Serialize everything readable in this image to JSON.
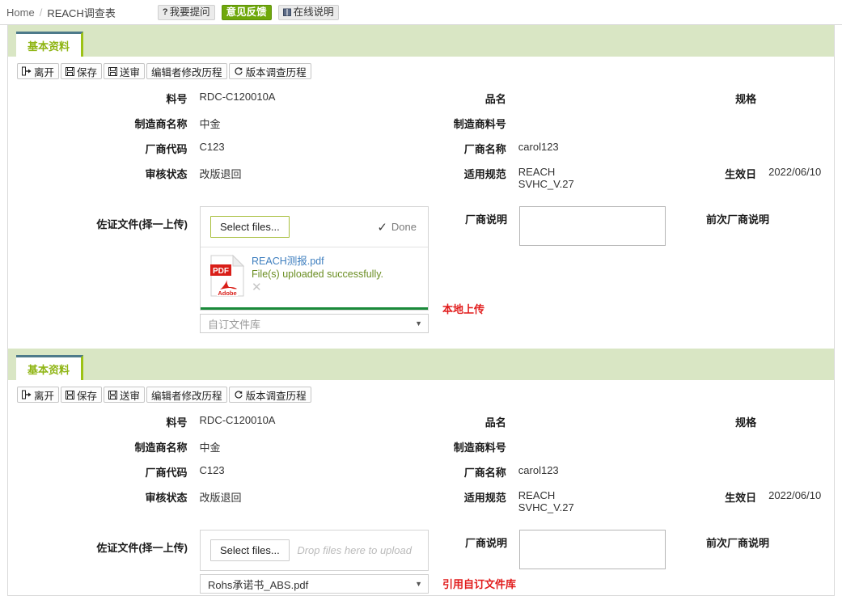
{
  "breadcrumb": {
    "home": "Home",
    "separator": "/",
    "current": "REACH调查表"
  },
  "header_buttons": [
    {
      "label": "我要提问",
      "icon": "question-mark-icon",
      "style": "plain"
    },
    {
      "label": "意见反馈",
      "icon": "none",
      "style": "accent"
    },
    {
      "label": "在线说明",
      "icon": "book-icon",
      "style": "plain"
    }
  ],
  "tab": {
    "label": "基本资料"
  },
  "toolbar": [
    {
      "label": "离开",
      "icon": "exit-icon"
    },
    {
      "label": "保存",
      "icon": "save-icon"
    },
    {
      "label": "送审",
      "icon": "save-icon"
    },
    {
      "label": "编辑者修改历程",
      "icon": "none"
    },
    {
      "label": "版本调查历程",
      "icon": "history-icon"
    }
  ],
  "fields": {
    "part_no_label": "料号",
    "part_no_value": "RDC-C120010A",
    "product_name_label": "品名",
    "product_name_value": "",
    "spec_label": "规格",
    "spec_value": "",
    "maker_name_label": "制造商名称",
    "maker_name_value": "中金",
    "maker_part_label": "制造商料号",
    "maker_part_value": "",
    "vendor_code_label": "厂商代码",
    "vendor_code_value": "C123",
    "vendor_name_label": "厂商名称",
    "vendor_name_value": "carol123",
    "review_status_label": "审核状态",
    "review_status_value": "改版退回",
    "regulation_label": "适用规范",
    "regulation_value": "REACH\nSVHC_V.27",
    "effective_date_label": "生效日",
    "effective_date_value": "2022/06/10",
    "attachment_label": "佐证文件(择一上传)",
    "vendor_remark_label": "厂商说明",
    "vendor_remark_value": "",
    "prev_vendor_remark_label": "前次厂商说明"
  },
  "panel_top": {
    "uploader": {
      "select_label": "Select files...",
      "status_label": "Done",
      "status_icon": "check-icon",
      "file_name": "REACH测报.pdf",
      "file_status": "File(s) uploaded successfully.",
      "file_icon": "pdf-file-icon",
      "remove_icon": "close-icon",
      "progress_percent": 100
    },
    "combo": {
      "value": "自订文件库",
      "is_placeholder": true,
      "arrow_icon": "chevron-down-icon"
    },
    "note": "本地上传"
  },
  "panel_bottom": {
    "uploader": {
      "select_label": "Select files...",
      "drop_hint": "Drop files here to upload",
      "file_name": "",
      "file_status": ""
    },
    "combo": {
      "value": "Rohs承诺书_ABS.pdf",
      "is_placeholder": false,
      "arrow_icon": "chevron-down-icon"
    },
    "note": "引用自订文件库"
  },
  "colors": {
    "accent_green": "#6fa80b",
    "tab_strip": "#d9e6c4",
    "tab_label": "#8fb514",
    "tab_top_border": "#4d7a8a",
    "tab_right_border": "#9cc215",
    "progress_green": "#1a8a3a",
    "note_red": "#e11b1b",
    "link_blue": "#3f7fbf",
    "success_olive": "#6b8e23"
  }
}
